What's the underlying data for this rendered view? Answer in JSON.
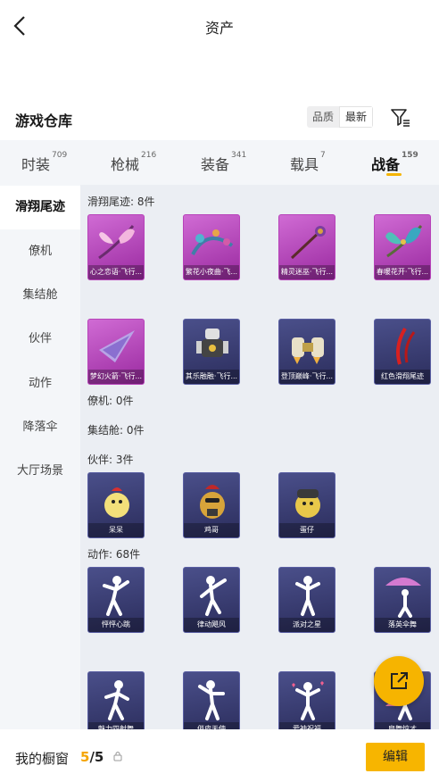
{
  "header": {
    "title": "资产"
  },
  "section": {
    "title": "游戏仓库"
  },
  "sort": {
    "options": [
      "品质",
      "最新"
    ],
    "active": "最新"
  },
  "tabs": [
    {
      "label": "时装",
      "count": "709"
    },
    {
      "label": "枪械",
      "count": "216"
    },
    {
      "label": "装备",
      "count": "341"
    },
    {
      "label": "载具",
      "count": "7"
    },
    {
      "label": "战备",
      "count": "159",
      "active": true
    }
  ],
  "sidebar": {
    "items": [
      "滑翔尾迹",
      "僚机",
      "集结舱",
      "伙伴",
      "动作",
      "降落伞",
      "大厅场景"
    ],
    "active": "滑翔尾迹"
  },
  "content": {
    "glide": {
      "label": "滑翔尾迹: 8件",
      "items": [
        "心之恋语·飞行...",
        "繁花小夜曲·飞...",
        "精灵迷巫·飞行...",
        "春暖花开·飞行...",
        "梦幻火箭·飞行...",
        "其乐融融·飞行...",
        "登顶巅峰·飞行...",
        "红色滑翔尾迹"
      ]
    },
    "wingman": {
      "label": "僚机: 0件"
    },
    "pod": {
      "label": "集结舱: 0件"
    },
    "partner": {
      "label": "伙伴: 3件",
      "items": [
        "呆呆",
        "鸡哥",
        "蛋仔"
      ]
    },
    "emote": {
      "label": "动作: 68件",
      "items": [
        "怦怦心跳",
        "律动飓风",
        "派对之星",
        "落英伞舞",
        "魅力四射舞",
        "俏皮天使",
        "爱神祝福",
        "扇舞惊才"
      ]
    }
  },
  "bottom": {
    "label": "我的橱窗",
    "current": "5",
    "separator": "/",
    "total": "5",
    "edit_label": "编辑"
  },
  "colors": {
    "accent": "#f7b500",
    "pink_card": "#b743b9",
    "blue_card": "#3a3e78"
  }
}
